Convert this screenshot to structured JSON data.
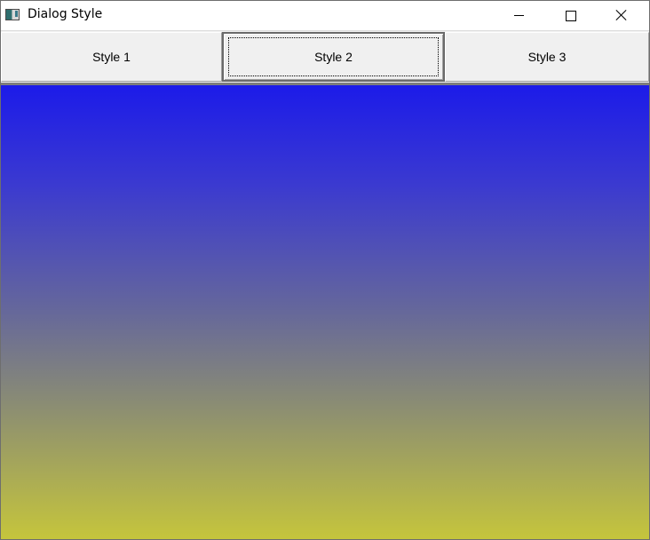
{
  "window": {
    "title": "Dialog Style",
    "icon": "app-window-icon"
  },
  "title_buttons": [
    {
      "name": "minimize",
      "icon": "minimize-icon"
    },
    {
      "name": "maximize",
      "icon": "maximize-icon"
    },
    {
      "name": "close",
      "icon": "close-icon"
    }
  ],
  "buttons": [
    {
      "label": "Style 1",
      "focused": false
    },
    {
      "label": "Style 2",
      "focused": true
    },
    {
      "label": "Style 3",
      "focused": false
    }
  ],
  "canvas": {
    "gradient": {
      "direction": "top-to-bottom",
      "top_color": "#1c1be9",
      "bottom_color": "#c5c53c"
    }
  }
}
